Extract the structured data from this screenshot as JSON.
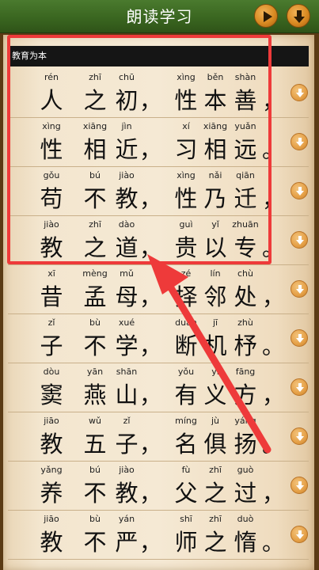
{
  "app": {
    "title": "朗读学习"
  },
  "toolbar": {
    "play_icon": "play-icon",
    "download_icon": "download-icon"
  },
  "section": {
    "title": "教育为本"
  },
  "rows": [
    {
      "line1": [
        [
          "rén",
          "人"
        ],
        [
          "zhī",
          "之"
        ],
        [
          "chū",
          "初"
        ]
      ],
      "p1": "，",
      "line2": [
        [
          "xìng",
          "性"
        ],
        [
          "běn",
          "本"
        ],
        [
          "shàn",
          "善"
        ]
      ],
      "p2": "，"
    },
    {
      "line1": [
        [
          "xìng",
          "性"
        ],
        [
          "xiāng",
          "相"
        ],
        [
          "jìn",
          "近"
        ]
      ],
      "p1": "，",
      "line2": [
        [
          "xí",
          "习"
        ],
        [
          "xiāng",
          "相"
        ],
        [
          "yuǎn",
          "远"
        ]
      ],
      "p2": "。"
    },
    {
      "line1": [
        [
          "gǒu",
          "苟"
        ],
        [
          "bú",
          "不"
        ],
        [
          "jiào",
          "教"
        ]
      ],
      "p1": "，",
      "line2": [
        [
          "xìng",
          "性"
        ],
        [
          "nǎi",
          "乃"
        ],
        [
          "qiān",
          "迁"
        ]
      ],
      "p2": "，"
    },
    {
      "line1": [
        [
          "jiào",
          "教"
        ],
        [
          "zhī",
          "之"
        ],
        [
          "dào",
          "道"
        ]
      ],
      "p1": "，",
      "line2": [
        [
          "guì",
          "贵"
        ],
        [
          "yǐ",
          "以"
        ],
        [
          "zhuān",
          "专"
        ]
      ],
      "p2": "。"
    },
    {
      "line1": [
        [
          "xī",
          "昔"
        ],
        [
          "mèng",
          "孟"
        ],
        [
          "mǔ",
          "母"
        ]
      ],
      "p1": "，",
      "line2": [
        [
          "zé",
          "择"
        ],
        [
          "lín",
          "邻"
        ],
        [
          "chù",
          "处"
        ]
      ],
      "p2": "，"
    },
    {
      "line1": [
        [
          "zǐ",
          "子"
        ],
        [
          "bù",
          "不"
        ],
        [
          "xué",
          "学"
        ]
      ],
      "p1": "，",
      "line2": [
        [
          "duàn",
          "断"
        ],
        [
          "jī",
          "机"
        ],
        [
          "zhù",
          "杼"
        ]
      ],
      "p2": "。"
    },
    {
      "line1": [
        [
          "dòu",
          "窦"
        ],
        [
          "yān",
          "燕"
        ],
        [
          "shān",
          "山"
        ]
      ],
      "p1": "，",
      "line2": [
        [
          "yǒu",
          "有"
        ],
        [
          "yì",
          "义"
        ],
        [
          "fāng",
          "方"
        ]
      ],
      "p2": "，"
    },
    {
      "line1": [
        [
          "jiāo",
          "教"
        ],
        [
          "wǔ",
          "五"
        ],
        [
          "zǐ",
          "子"
        ]
      ],
      "p1": "，",
      "line2": [
        [
          "míng",
          "名"
        ],
        [
          "jù",
          "俱"
        ],
        [
          "yáng",
          "扬"
        ]
      ],
      "p2": "。"
    },
    {
      "line1": [
        [
          "yǎng",
          "养"
        ],
        [
          "bú",
          "不"
        ],
        [
          "jiào",
          "教"
        ]
      ],
      "p1": "，",
      "line2": [
        [
          "fù",
          "父"
        ],
        [
          "zhī",
          "之"
        ],
        [
          "guò",
          "过"
        ]
      ],
      "p2": "，"
    },
    {
      "line1": [
        [
          "jiāo",
          "教"
        ],
        [
          "bù",
          "不"
        ],
        [
          "yán",
          "严"
        ]
      ],
      "p1": "，",
      "line2": [
        [
          "shī",
          "师"
        ],
        [
          "zhī",
          "之"
        ],
        [
          "duò",
          "惰"
        ]
      ],
      "p2": "。"
    }
  ],
  "colors": {
    "titlebar": "#3a6620",
    "header_bg": "#151515",
    "annotation": "#ee3a3a",
    "button": "#d98a22"
  }
}
